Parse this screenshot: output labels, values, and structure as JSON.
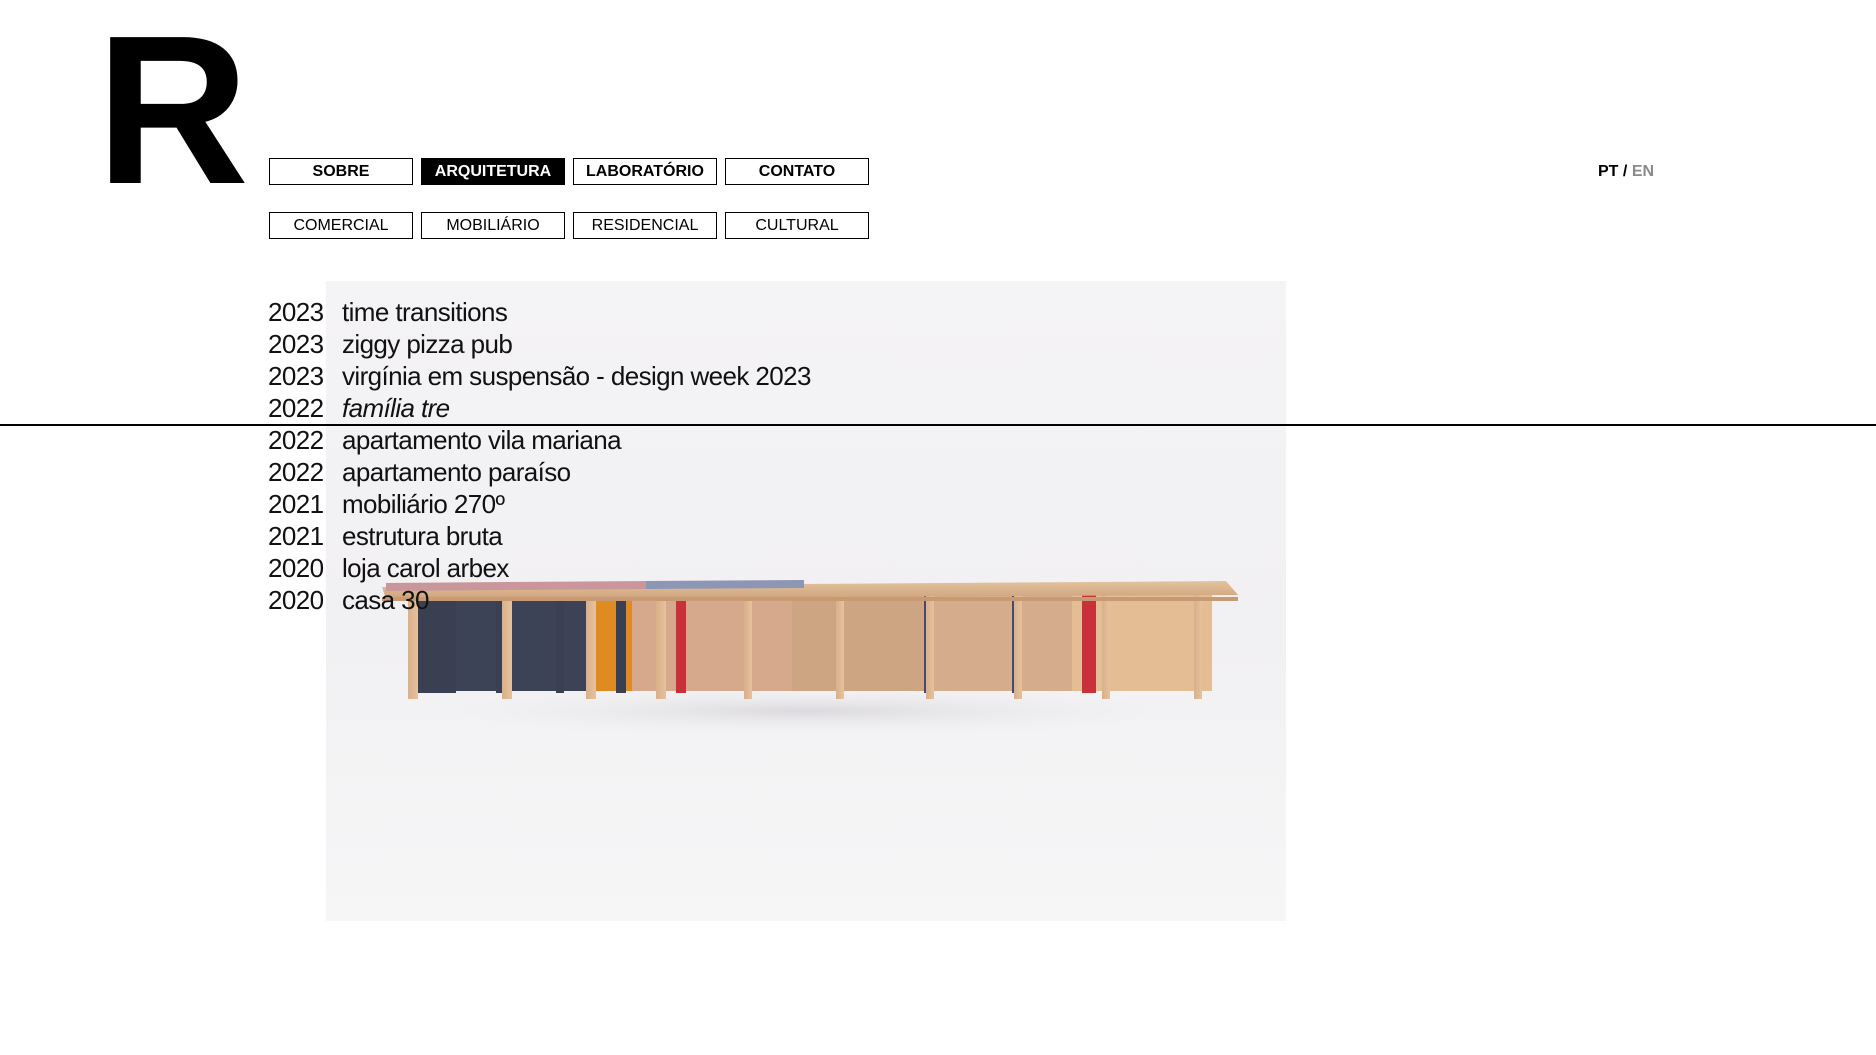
{
  "logo": {
    "text": "R"
  },
  "nav": {
    "primary": [
      {
        "label": "SOBRE",
        "active": false
      },
      {
        "label": "ARQUITETURA",
        "active": true
      },
      {
        "label": "LABORATÓRIO",
        "active": false
      },
      {
        "label": "CONTATO",
        "active": false
      }
    ],
    "secondary": [
      {
        "label": "COMERCIAL"
      },
      {
        "label": "MOBILIÁRIO"
      },
      {
        "label": "RESIDENCIAL"
      },
      {
        "label": "CULTURAL"
      }
    ]
  },
  "language": {
    "current": "PT",
    "separator": "/",
    "other": "EN"
  },
  "projects": [
    {
      "year": "2023",
      "name": "time transitions"
    },
    {
      "year": "2023",
      "name": "ziggy pizza pub"
    },
    {
      "year": "2023",
      "name": "virgínia em suspensão - design week 2023"
    },
    {
      "year": "2022",
      "name": "família tre",
      "hovered": true
    },
    {
      "year": "2022",
      "name": "apartamento vila mariana"
    },
    {
      "year": "2022",
      "name": "apartamento paraíso"
    },
    {
      "year": "2021",
      "name": "mobiliário 270º"
    },
    {
      "year": "2021",
      "name": "estrutura bruta"
    },
    {
      "year": "2020",
      "name": "loja carol arbex"
    },
    {
      "year": "2020",
      "name": "casa 30"
    }
  ],
  "colors": {
    "accent": "#000000",
    "muted": "#8a8a8a",
    "plywood": "#d9b48f",
    "navy": "#3a4052",
    "orange": "#e58a1f",
    "red": "#c8303a",
    "blue_top": "#8d96b4",
    "pink_top": "#c9969c"
  },
  "preview_image": {
    "icon": "plywood-shelf-photo"
  }
}
